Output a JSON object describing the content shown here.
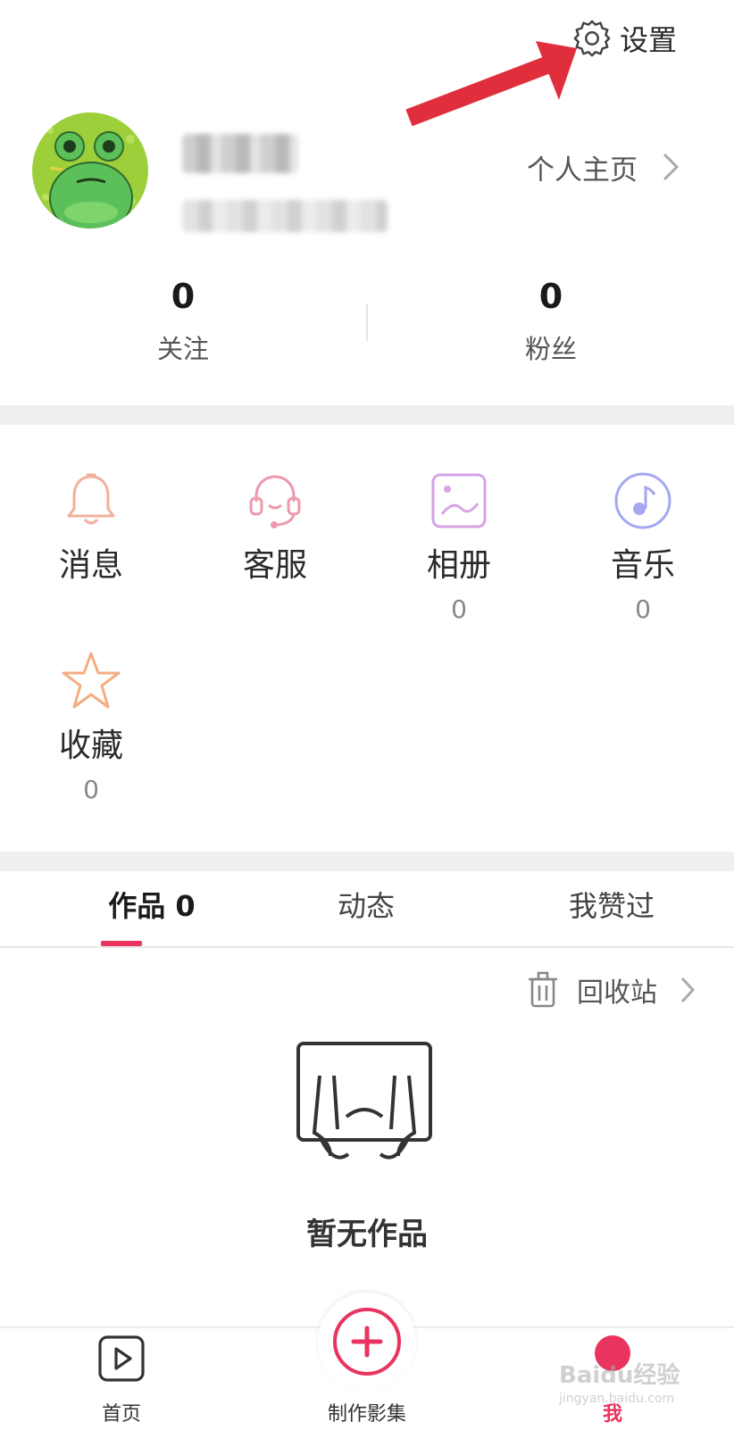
{
  "header": {
    "settings_label": "设置",
    "homepage_label": "个人主页"
  },
  "stats": {
    "following_count": "0",
    "following_label": "关注",
    "fans_count": "0",
    "fans_label": "粉丝"
  },
  "menu": {
    "messages": {
      "label": "消息"
    },
    "service": {
      "label": "客服"
    },
    "album": {
      "label": "相册",
      "count": "0"
    },
    "music": {
      "label": "音乐",
      "count": "0"
    },
    "favorites": {
      "label": "收藏",
      "count": "0"
    }
  },
  "tabs": {
    "works": "作品 0",
    "activity": "动态",
    "liked": "我赞过"
  },
  "recycle_label": "回收站",
  "empty_text": "暂无作品",
  "bottom_nav": {
    "home": "首页",
    "create": "制作影集",
    "me": "我"
  },
  "watermark": {
    "main": "Baidu经验",
    "sub": "jingyan.baidu.com"
  },
  "colors": {
    "accent": "#e8345e",
    "arrow": "#e02e3c"
  }
}
